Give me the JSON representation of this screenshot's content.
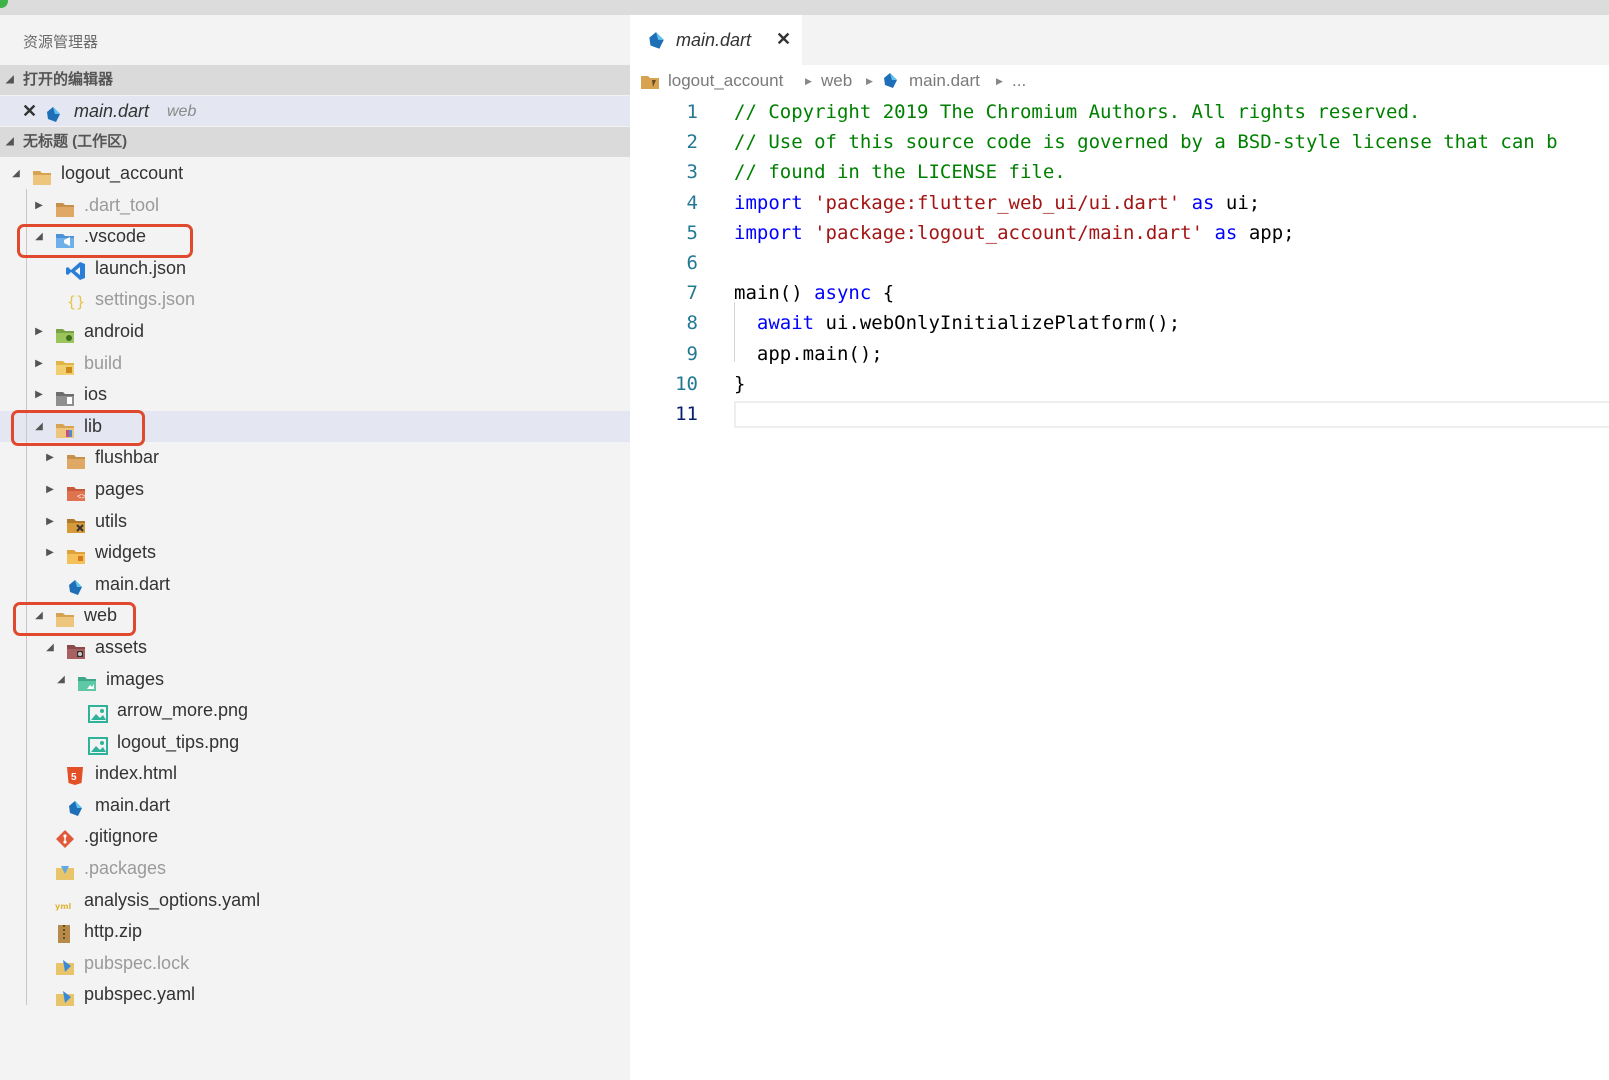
{
  "colors": {
    "highlight_box": "#e0492e",
    "selection_bg": "#e4e6f1",
    "comment": "#008000",
    "keyword": "#0000ff",
    "string": "#a31515",
    "line_number": "#237893"
  },
  "explorer": {
    "title": "资源管理器",
    "open_editors_header": "打开的编辑器",
    "workspace_header": "无标题 (工作区)",
    "open_editor": {
      "file": "main.dart",
      "folder": "web",
      "icon": "dart-icon"
    }
  },
  "tree": [
    {
      "label": "logout_account",
      "depth": 0,
      "expanded": true,
      "icon": "folder-open-icon",
      "dim": false
    },
    {
      "label": ".dart_tool",
      "depth": 1,
      "expanded": false,
      "icon": "folder-icon",
      "dim": true
    },
    {
      "label": ".vscode",
      "depth": 1,
      "expanded": true,
      "icon": "vscode-folder-icon",
      "dim": false,
      "highlight": true
    },
    {
      "label": "launch.json",
      "depth": 2,
      "file": true,
      "icon": "vscode-icon",
      "dim": false
    },
    {
      "label": "settings.json",
      "depth": 2,
      "file": true,
      "icon": "json-braces-icon",
      "dim": true
    },
    {
      "label": "android",
      "depth": 1,
      "expanded": false,
      "icon": "android-folder-icon",
      "dim": false
    },
    {
      "label": "build",
      "depth": 1,
      "expanded": false,
      "icon": "build-folder-icon",
      "dim": true
    },
    {
      "label": "ios",
      "depth": 1,
      "expanded": false,
      "icon": "ios-folder-icon",
      "dim": false
    },
    {
      "label": "lib",
      "depth": 1,
      "expanded": true,
      "icon": "lib-folder-icon",
      "dim": false,
      "highlight": true,
      "selected": true
    },
    {
      "label": "flushbar",
      "depth": 2,
      "expanded": false,
      "icon": "folder-icon",
      "dim": false
    },
    {
      "label": "pages",
      "depth": 2,
      "expanded": false,
      "icon": "pages-folder-icon",
      "dim": false
    },
    {
      "label": "utils",
      "depth": 2,
      "expanded": false,
      "icon": "utils-folder-icon",
      "dim": false
    },
    {
      "label": "widgets",
      "depth": 2,
      "expanded": false,
      "icon": "widgets-folder-icon",
      "dim": false
    },
    {
      "label": "main.dart",
      "depth": 2,
      "file": true,
      "icon": "dart-icon",
      "dim": false
    },
    {
      "label": "web",
      "depth": 1,
      "expanded": true,
      "icon": "folder-open-icon",
      "dim": false,
      "highlight": true
    },
    {
      "label": "assets",
      "depth": 2,
      "expanded": true,
      "icon": "assets-folder-icon",
      "dim": false
    },
    {
      "label": "images",
      "depth": 3,
      "expanded": true,
      "icon": "images-folder-icon",
      "dim": false
    },
    {
      "label": "arrow_more.png",
      "depth": 4,
      "file": true,
      "icon": "image-icon",
      "dim": false
    },
    {
      "label": "logout_tips.png",
      "depth": 4,
      "file": true,
      "icon": "image-icon",
      "dim": false
    },
    {
      "label": "index.html",
      "depth": 2,
      "file": true,
      "icon": "html5-icon",
      "dim": false
    },
    {
      "label": "main.dart",
      "depth": 2,
      "file": true,
      "icon": "dart-icon",
      "dim": false
    },
    {
      "label": ".gitignore",
      "depth": 1,
      "file": true,
      "icon": "git-icon",
      "dim": false
    },
    {
      "label": ".packages",
      "depth": 1,
      "file": true,
      "icon": "packages-icon",
      "dim": true
    },
    {
      "label": "analysis_options.yaml",
      "depth": 1,
      "file": true,
      "icon": "yaml-icon",
      "dim": false
    },
    {
      "label": "http.zip",
      "depth": 1,
      "file": true,
      "icon": "zip-icon",
      "dim": false
    },
    {
      "label": "pubspec.lock",
      "depth": 1,
      "file": true,
      "icon": "pubspec-icon",
      "dim": true
    },
    {
      "label": "pubspec.yaml",
      "depth": 1,
      "file": true,
      "icon": "pubspec-icon",
      "dim": false
    }
  ],
  "editor": {
    "tab": {
      "label": "main.dart",
      "close": "✕"
    },
    "breadcrumb": [
      "logout_account",
      "web",
      "main.dart",
      "..."
    ],
    "lines": [
      {
        "n": "1",
        "tokens": [
          {
            "t": "// Copyright 2019 The Chromium Authors. All rights reserved.",
            "c": "cm"
          }
        ]
      },
      {
        "n": "2",
        "tokens": [
          {
            "t": "// Use of this source code is governed by a BSD-style license that can b",
            "c": "cm"
          }
        ]
      },
      {
        "n": "3",
        "tokens": [
          {
            "t": "// found in the LICENSE file.",
            "c": "cm"
          }
        ]
      },
      {
        "n": "4",
        "tokens": [
          {
            "t": "import",
            "c": "kw"
          },
          {
            "t": " "
          },
          {
            "t": "'package:flutter_web_ui/ui.dart'",
            "c": "str"
          },
          {
            "t": " "
          },
          {
            "t": "as",
            "c": "kw"
          },
          {
            "t": " ui;"
          }
        ]
      },
      {
        "n": "5",
        "tokens": [
          {
            "t": "import",
            "c": "kw"
          },
          {
            "t": " "
          },
          {
            "t": "'package:logout_account/main.dart'",
            "c": "str"
          },
          {
            "t": " "
          },
          {
            "t": "as",
            "c": "kw"
          },
          {
            "t": " app;"
          }
        ]
      },
      {
        "n": "6",
        "tokens": []
      },
      {
        "n": "7",
        "tokens": [
          {
            "t": "main() "
          },
          {
            "t": "async",
            "c": "kw"
          },
          {
            "t": " {"
          }
        ]
      },
      {
        "n": "8",
        "tokens": [
          {
            "t": "  "
          },
          {
            "t": "await",
            "c": "kw"
          },
          {
            "t": " ui.webOnlyInitializePlatform();"
          }
        ]
      },
      {
        "n": "9",
        "tokens": [
          {
            "t": "  app.main();"
          }
        ]
      },
      {
        "n": "10",
        "tokens": [
          {
            "t": "}"
          }
        ]
      },
      {
        "n": "11",
        "tokens": [],
        "active": true
      }
    ]
  }
}
